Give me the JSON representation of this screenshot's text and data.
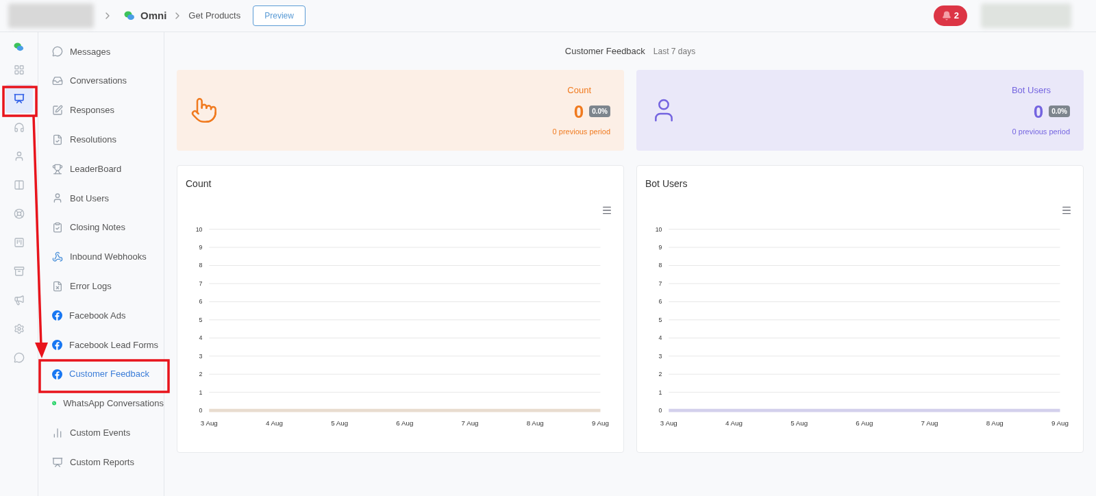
{
  "breadcrumb": {
    "items": [
      "Omni",
      "Get Products"
    ],
    "button": "Preview"
  },
  "notifications": {
    "count": "2"
  },
  "rail": [
    {
      "selected": false
    },
    {
      "selected": true
    },
    {
      "selected": false
    },
    {
      "selected": false
    },
    {
      "selected": false
    },
    {
      "selected": false
    },
    {
      "selected": false
    },
    {
      "selected": false
    },
    {
      "selected": false
    },
    {
      "selected": false
    },
    {
      "selected": false
    }
  ],
  "sidebar": {
    "items": [
      {
        "label": "Messages",
        "selected": false
      },
      {
        "label": "Conversations",
        "selected": false
      },
      {
        "label": "Responses",
        "selected": false
      },
      {
        "label": "Resolutions",
        "selected": false
      },
      {
        "label": "LeaderBoard",
        "selected": false
      },
      {
        "label": "Bot Users",
        "selected": false
      },
      {
        "label": "Closing Notes",
        "selected": false
      },
      {
        "label": "Inbound Webhooks",
        "selected": false
      },
      {
        "label": "Error Logs",
        "selected": false
      },
      {
        "label": "Facebook Ads",
        "selected": false
      },
      {
        "label": "Facebook Lead Forms",
        "selected": false
      },
      {
        "label": "Customer Feedback",
        "selected": true
      },
      {
        "label": "WhatsApp Conversations",
        "selected": false
      },
      {
        "label": "Custom Events",
        "selected": false
      },
      {
        "label": "Custom Reports",
        "selected": false
      }
    ]
  },
  "header": {
    "title": "Customer Feedback",
    "period": "Last 7 days"
  },
  "stats": [
    {
      "kind": "count",
      "label": "Count",
      "value": "0",
      "change": "0.0%",
      "previous": "0 previous period",
      "color": "#f07a1f"
    },
    {
      "kind": "users",
      "label": "Bot Users",
      "value": "0",
      "change": "0.0%",
      "previous": "0 previous period",
      "color": "#7464e0"
    }
  ],
  "charts": [
    {
      "title": "Count",
      "chart_data": {
        "type": "line",
        "categories": [
          "3 Aug",
          "4 Aug",
          "5 Aug",
          "6 Aug",
          "7 Aug",
          "8 Aug",
          "9 Aug"
        ],
        "series": [
          {
            "color": "#e9dccf",
            "values": [
              0,
              0,
              0,
              0,
              0,
              0,
              0
            ]
          }
        ],
        "ylim": [
          0,
          10
        ],
        "yticks": [
          0,
          1,
          2,
          3,
          4,
          5,
          6,
          7,
          8,
          9,
          10
        ],
        "grid": true
      }
    },
    {
      "title": "Bot Users",
      "chart_data": {
        "type": "line",
        "categories": [
          "3 Aug",
          "4 Aug",
          "5 Aug",
          "6 Aug",
          "7 Aug",
          "8 Aug",
          "9 Aug"
        ],
        "series": [
          {
            "color": "#d3d0ec",
            "values": [
              0,
              0,
              0,
              0,
              0,
              0,
              0
            ]
          }
        ],
        "ylim": [
          0,
          10
        ],
        "yticks": [
          0,
          1,
          2,
          3,
          4,
          5,
          6,
          7,
          8,
          9,
          10
        ],
        "grid": true
      }
    }
  ]
}
